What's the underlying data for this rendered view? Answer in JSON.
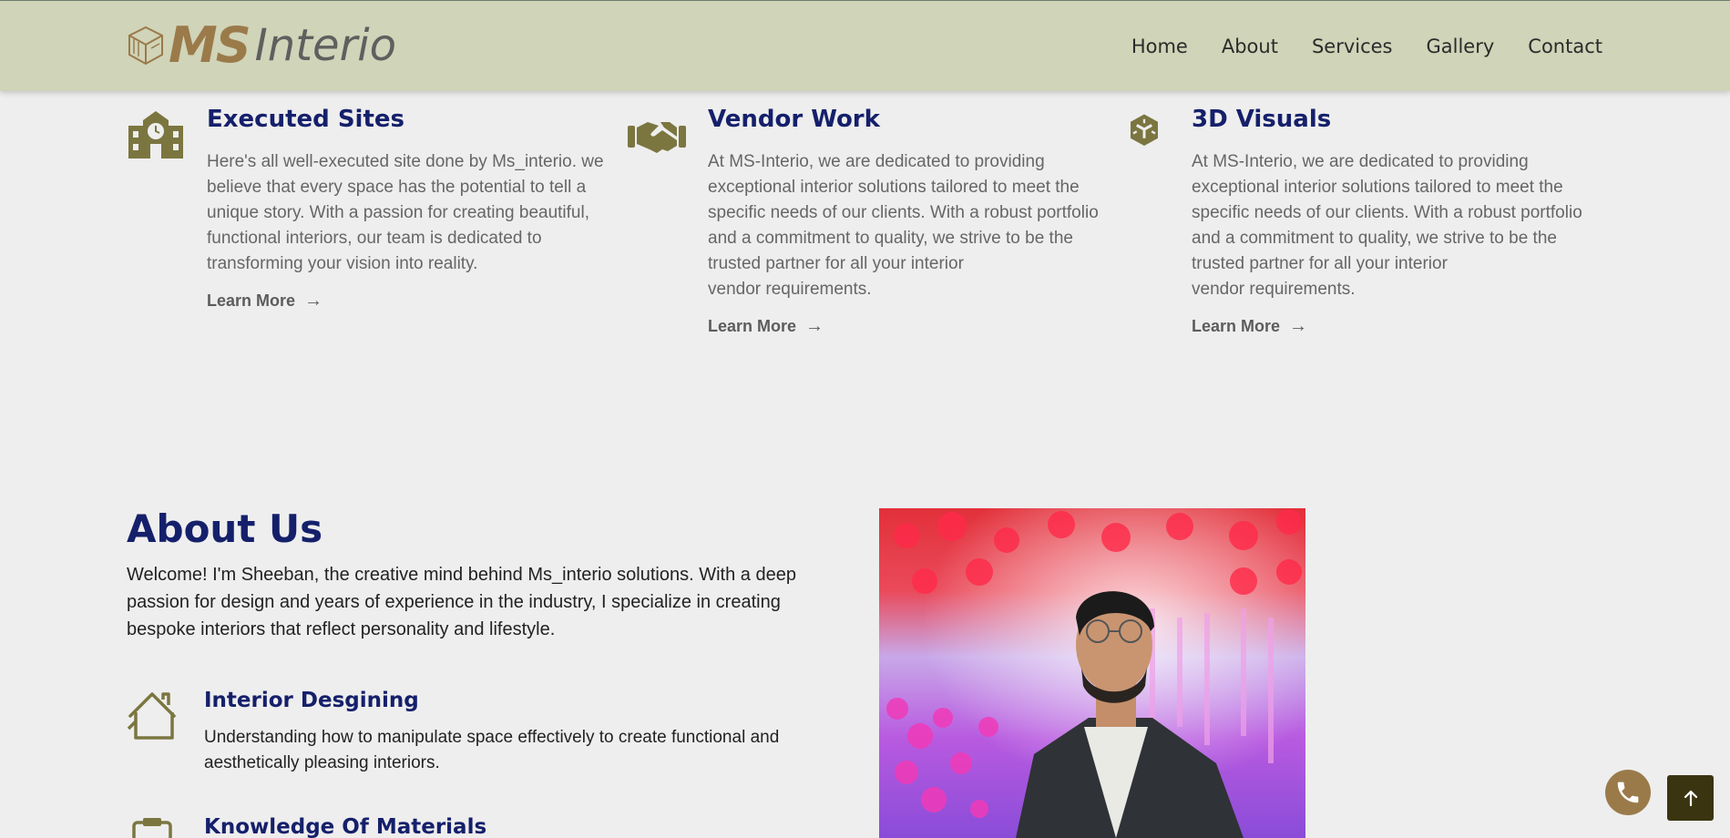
{
  "brand": {
    "logo_ms": "MS",
    "logo_interio": "Interio"
  },
  "nav": [
    "Home",
    "About",
    "Services",
    "Gallery",
    "Contact"
  ],
  "services": [
    {
      "title": "Executed Sites",
      "icon": "school-building-icon",
      "lines": [
        "Here's all well-executed site done by Ms_interio. we",
        "believe that every space has the potential to tell a",
        "unique story. With a passion for creating beautiful,",
        "functional interiors, our team is dedicated to",
        "transforming your vision into reality."
      ],
      "link": "Learn More"
    },
    {
      "title": "Vendor Work",
      "icon": "handshake-icon",
      "lines": [
        "At MS-Interio, we are dedicated to providing",
        "exceptional interior solutions tailored to meet the",
        "specific needs of our clients. With a robust portfolio",
        "and a commitment to quality, we strive to be the",
        "trusted partner for all your interior",
        "vendor requirements."
      ],
      "link": "Learn More"
    },
    {
      "title": "3D Visuals",
      "icon": "3d-cube-icon",
      "lines": [
        "At MS-Interio, we are dedicated to providing",
        "exceptional interior solutions tailored to meet the",
        "specific needs of our clients. With a robust portfolio",
        "and a commitment to quality, we strive to be the",
        "trusted partner for all your interior",
        "vendor requirements."
      ],
      "link": "Learn More"
    }
  ],
  "about": {
    "title": "About Us",
    "lines": [
      "Welcome! I'm Sheeban, the creative mind behind Ms_interio solutions. With a deep",
      "passion for design and years of experience in the industry, I specialize in creating",
      "bespoke interiors that reflect personality and lifestyle."
    ],
    "features": [
      {
        "title": "Interior Desgining",
        "icon": "house-icon",
        "lines": [
          "Understanding how to manipulate space effectively to create functional and",
          "aesthetically pleasing interiors."
        ]
      },
      {
        "title": "Knowledge Of Materials",
        "icon": "clipboard-icon",
        "lines": []
      }
    ]
  },
  "colors": {
    "header_bg": "#d0d4b8",
    "accent_olive": "#7b7640",
    "brand_gold": "#9b7a4a",
    "heading_navy": "#15206b"
  },
  "floating": {
    "call_icon": "phone-icon",
    "top_icon": "arrow-up-icon"
  }
}
